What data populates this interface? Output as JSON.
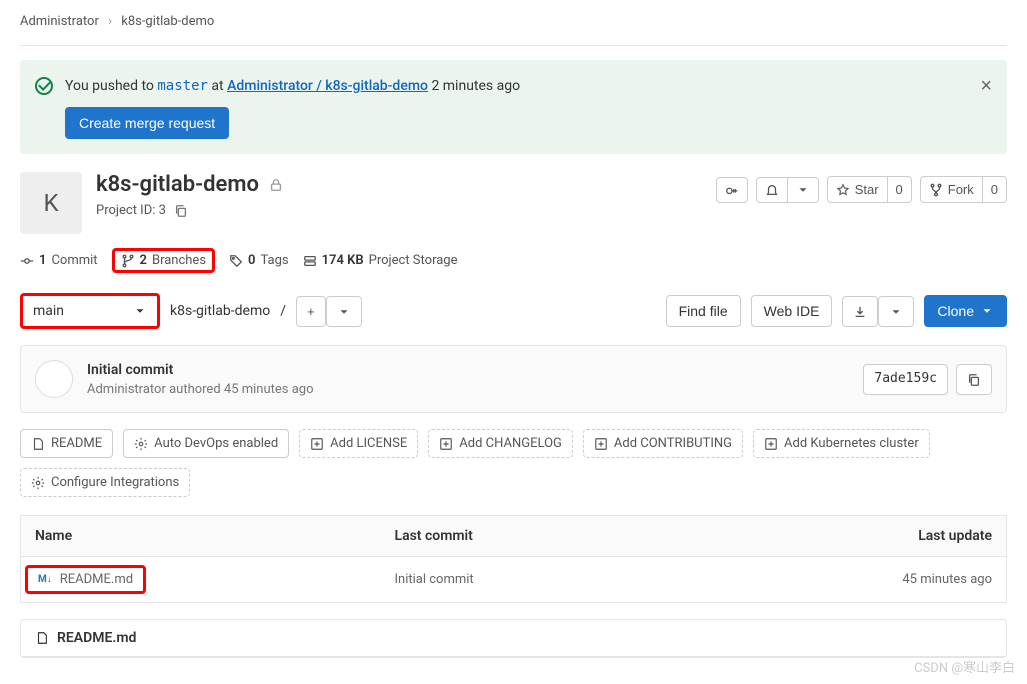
{
  "breadcrumb": {
    "root": "Administrator",
    "project": "k8s-gitlab-demo"
  },
  "alert": {
    "prefix": "You pushed to ",
    "branch": "master",
    "at": " at ",
    "link": "Administrator / k8s-gitlab-demo",
    "time": " 2 minutes ago",
    "button": "Create merge request",
    "close": "×"
  },
  "project": {
    "avatar_letter": "K",
    "title": "k8s-gitlab-demo",
    "id_label": "Project ID: 3"
  },
  "actions": {
    "star_label": "Star",
    "star_count": "0",
    "fork_label": "Fork",
    "fork_count": "0"
  },
  "stats": {
    "commits_n": "1",
    "commits": "Commit",
    "branches_n": "2",
    "branches": "Branches",
    "tags_n": "0",
    "tags": "Tags",
    "storage_n": "174 KB",
    "storage": "Project Storage"
  },
  "toolbar": {
    "branch": "main",
    "path": "k8s-gitlab-demo",
    "slash": "/",
    "plus": "+",
    "find_file": "Find file",
    "web_ide": "Web IDE",
    "clone": "Clone"
  },
  "commit": {
    "title": "Initial commit",
    "author": "Administrator",
    "meta": " authored 45 minutes ago",
    "sha": "7ade159c"
  },
  "chips": {
    "readme": "README",
    "auto_devops": "Auto DevOps enabled",
    "add_license": "Add LICENSE",
    "add_changelog": "Add CHANGELOG",
    "add_contributing": "Add CONTRIBUTING",
    "add_k8s": "Add Kubernetes cluster",
    "configure": "Configure Integrations"
  },
  "table": {
    "col_name": "Name",
    "col_commit": "Last commit",
    "col_update": "Last update",
    "rows": [
      {
        "icon": "M↓",
        "name": "README.md",
        "commit": "Initial commit",
        "update": "45 minutes ago"
      }
    ]
  },
  "readme_panel": {
    "title": "README.md"
  },
  "watermark": "CSDN @寒山李白"
}
